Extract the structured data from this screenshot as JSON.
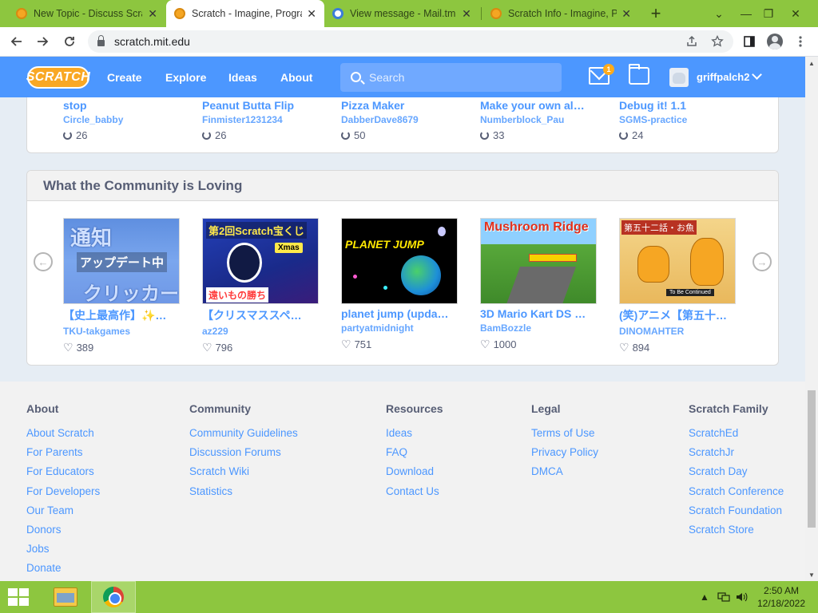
{
  "browser": {
    "tabs": [
      {
        "title": "New Topic - Discuss Scratch",
        "favicon": "scratch-favicon",
        "active": false
      },
      {
        "title": "Scratch - Imagine, Program, Share",
        "favicon": "scratch-favicon",
        "active": true
      },
      {
        "title": "View message - Mail.tm",
        "favicon": "mail-favicon",
        "active": false
      },
      {
        "title": "Scratch Info - Imagine, Program, Share",
        "favicon": "scratch-favicon",
        "active": false
      }
    ],
    "url": "scratch.mit.edu",
    "tab_close_glyph": "✕",
    "new_tab_glyph": "+",
    "window_controls": [
      "⌄",
      "—",
      "❐",
      "✕"
    ]
  },
  "nav": {
    "logo_text": "SCRATCH",
    "links": [
      "Create",
      "Explore",
      "Ideas",
      "About"
    ],
    "search_placeholder": "Search",
    "message_count": "1",
    "username": "griffpalch2",
    "brand_color": "#4c97ff"
  },
  "top_row": {
    "projects": [
      {
        "title": "stop",
        "author": "Circle_babby",
        "remixes": "26"
      },
      {
        "title": "Peanut Butta Flip",
        "author": "Finmister1231234",
        "remixes": "26"
      },
      {
        "title": "Pizza Maker",
        "author": "DabberDave8679",
        "remixes": "50"
      },
      {
        "title": "Make your own al…",
        "author": "Numberblock_Pau",
        "remixes": "33"
      },
      {
        "title": "Debug it! 1.1",
        "author": "SGMS-practice",
        "remixes": "24"
      }
    ]
  },
  "community_loving": {
    "heading": "What the Community is Loving",
    "projects": [
      {
        "title": "【史上最高作】✨…",
        "author": "TKU-takgames",
        "loves": "389",
        "thumb_text": [
          "通知",
          "アップデート中",
          "クリッカー"
        ]
      },
      {
        "title": "【クリスマススペ…",
        "author": "az229",
        "loves": "796",
        "thumb_text": [
          "第2回Scratch宝くじ",
          "Xmas",
          "遠いもの勝ち"
        ]
      },
      {
        "title": "planet jump (upda…",
        "author": "partyatmidnight",
        "loves": "751",
        "thumb_text": [
          "PLANET JUMP"
        ]
      },
      {
        "title": "3D Mario Kart DS …",
        "author": "BamBozzle",
        "loves": "1000",
        "thumb_text": [
          "Mushroom Ridge"
        ]
      },
      {
        "title": "(笑)アニメ【第五十…",
        "author": "DINOMAHTER",
        "loves": "894",
        "thumb_text": [
          "第五十二話・お魚",
          "To Be Continued"
        ]
      }
    ],
    "prev_glyph": "←",
    "next_glyph": "→"
  },
  "footer": {
    "columns": [
      {
        "heading": "About",
        "links": [
          "About Scratch",
          "For Parents",
          "For Educators",
          "For Developers",
          "Our Team",
          "Donors",
          "Jobs",
          "Donate"
        ]
      },
      {
        "heading": "Community",
        "links": [
          "Community Guidelines",
          "Discussion Forums",
          "Scratch Wiki",
          "Statistics"
        ]
      },
      {
        "heading": "Resources",
        "links": [
          "Ideas",
          "FAQ",
          "Download",
          "Contact Us"
        ]
      },
      {
        "heading": "Legal",
        "links": [
          "Terms of Use",
          "Privacy Policy",
          "DMCA"
        ]
      },
      {
        "heading": "Scratch Family",
        "links": [
          "ScratchEd",
          "ScratchJr",
          "Scratch Day",
          "Scratch Conference",
          "Scratch Foundation",
          "Scratch Store"
        ]
      }
    ]
  },
  "taskbar": {
    "time": "2:50 AM",
    "date": "12/18/2022",
    "tray_chevron": "▲"
  }
}
